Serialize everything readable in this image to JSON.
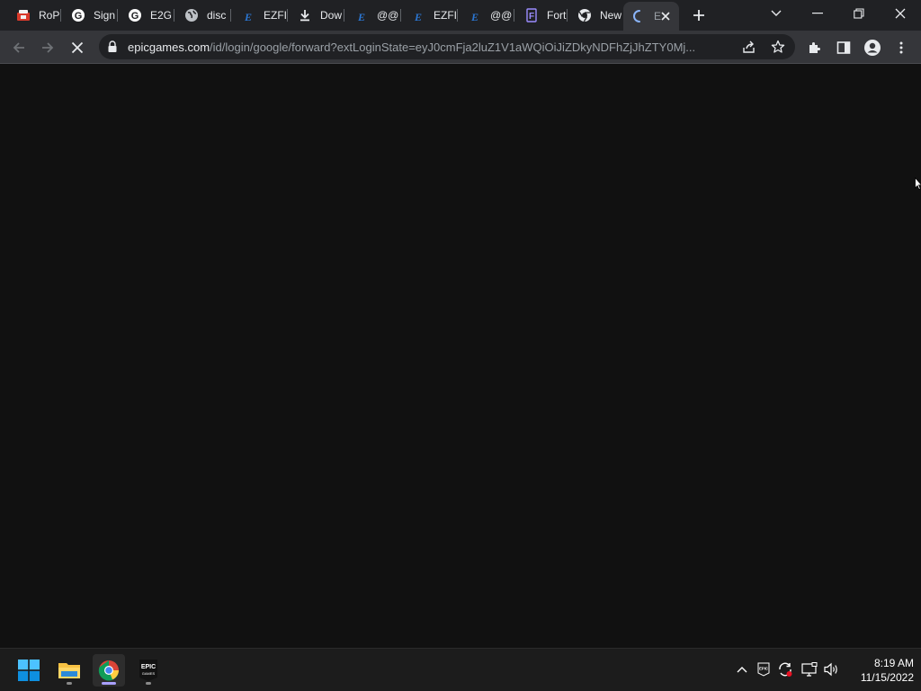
{
  "browser": {
    "tabs": [
      {
        "title": "RoPro",
        "icon": "ropro-icon",
        "active": false
      },
      {
        "title": "Sign",
        "icon": "google-icon",
        "active": false
      },
      {
        "title": "E2G",
        "icon": "google-icon",
        "active": false
      },
      {
        "title": "disc",
        "icon": "globe-icon",
        "active": false
      },
      {
        "title": "EZFI",
        "icon": "ezfi-icon",
        "active": false
      },
      {
        "title": "Dow",
        "icon": "download-icon",
        "active": false
      },
      {
        "title": "@@",
        "icon": "ezfi-icon",
        "active": false
      },
      {
        "title": "EZFI",
        "icon": "ezfi-icon",
        "active": false
      },
      {
        "title": "@@",
        "icon": "ezfi-icon",
        "active": false
      },
      {
        "title": "Fort",
        "icon": "fortnite-icon",
        "active": false
      },
      {
        "title": "New",
        "icon": "chrome-icon",
        "active": false
      },
      {
        "title": "E",
        "icon": "loading-spinner-icon",
        "active": true
      }
    ],
    "address_bar": {
      "host": "epicgames.com",
      "path": "/id/login/google/forward?extLoginState=eyJ0cmFja2luZ1V1aWQiOiJiZDkyNDFhZjJhZTY0Mj..."
    },
    "accent_color": "#a9a0ff"
  },
  "taskbar": {
    "apps": [
      {
        "name": "start-button",
        "icon": "windows-logo-icon"
      },
      {
        "name": "file-explorer",
        "icon": "folder-icon"
      },
      {
        "name": "chrome",
        "icon": "chrome-icon",
        "active": true
      },
      {
        "name": "epic-games",
        "icon": "epic-games-icon",
        "label": "EPIC\nGAMES"
      }
    ],
    "clock": {
      "time": "8:19 AM",
      "date": "11/15/2022"
    },
    "tray_epic_label": "EPIC"
  }
}
